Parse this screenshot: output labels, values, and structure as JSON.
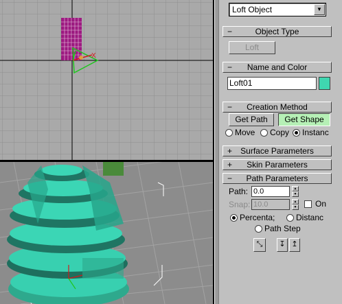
{
  "command_panel": {
    "object_type_dropdown": "Loft Object",
    "object_type": {
      "title": "Object Type",
      "sign": "−",
      "loft_button": "Loft"
    },
    "name_and_color": {
      "title": "Name and Color",
      "sign": "−",
      "name_value": "Loft01",
      "color": "#3fd6b0"
    },
    "creation_method": {
      "title": "Creation Method",
      "sign": "−",
      "get_path": "Get Path",
      "get_shape": "Get Shape",
      "move": "Move",
      "copy": "Copy",
      "instance": "Instanc"
    },
    "surface_parameters": {
      "title": "Surface Parameters",
      "sign": "+"
    },
    "skin_parameters": {
      "title": "Skin Parameters",
      "sign": "+"
    },
    "path_parameters": {
      "title": "Path Parameters",
      "sign": "−",
      "path_label": "Path:",
      "path_value": "0.0",
      "snap_label": "Snap:",
      "snap_value": "10.0",
      "on_label": "On",
      "percentage": "Percenta;",
      "distance": "Distanc",
      "path_steps": "Path Step"
    }
  },
  "colors": {
    "loft_teal": "#36d3b2",
    "shape_magenta": "#9b0a7c",
    "gizmo_green": "#1fc51f",
    "gizmo_red": "#d11a1a"
  }
}
